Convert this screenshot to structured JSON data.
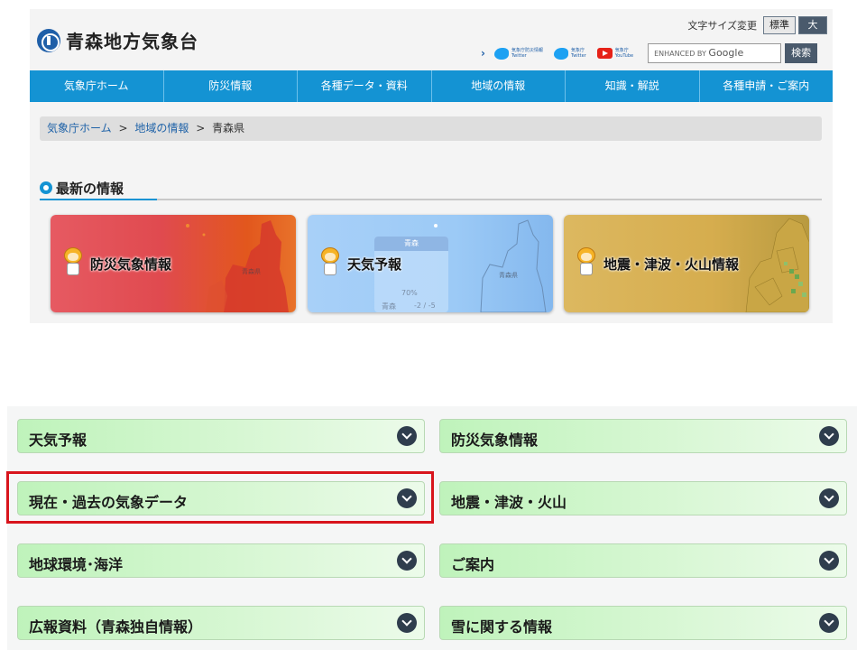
{
  "site": {
    "title": "青森地方気象台",
    "font_size": {
      "label": "文字サイズ変更",
      "standard": "標準",
      "large": "大"
    },
    "social": [
      {
        "icon": "twitter-icon",
        "line1": "気象庁防災情報",
        "line2": "Twitter"
      },
      {
        "icon": "twitter-icon",
        "line1": "気象庁",
        "line2": "Twitter"
      },
      {
        "icon": "youtube-icon",
        "line1": "気象庁",
        "line2": "YouTube"
      }
    ],
    "search": {
      "prefix": "ENHANCED BY",
      "brand": "Google",
      "button": "検索"
    },
    "nav": [
      "気象庁ホーム",
      "防災情報",
      "各種データ・資料",
      "地域の情報",
      "知識・解説",
      "各種申請・ご案内"
    ],
    "breadcrumb": {
      "home": "気象庁ホーム",
      "sep": ">",
      "region": "地域の情報",
      "current": "青森県"
    },
    "latest_title": "最新の情報",
    "cards": {
      "disaster": {
        "title": "防災気象情報",
        "map_label": "青森県"
      },
      "weather": {
        "title": "天気予報",
        "panel_head": "青森",
        "pct": "70%",
        "city": "青森",
        "temp": "-2 / -5",
        "map_label": "青森県"
      },
      "quake": {
        "title": "地震・津波・火山情報"
      }
    }
  },
  "menu": {
    "items": [
      {
        "label": "天気予報"
      },
      {
        "label": "防災気象情報"
      },
      {
        "label": "現在・過去の気象データ"
      },
      {
        "label": "地震・津波・火山"
      },
      {
        "label": "地球環境･海洋"
      },
      {
        "label": "ご案内"
      },
      {
        "label": "広報資料（青森独自情報）"
      },
      {
        "label": "雪に関する情報"
      }
    ],
    "highlight_color": "#d8141c"
  }
}
